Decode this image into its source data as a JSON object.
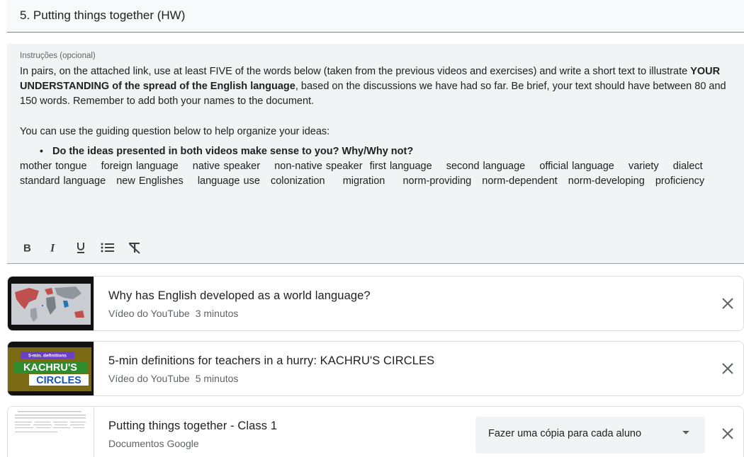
{
  "assignment_title": "5. Putting things together (HW)",
  "instructions": {
    "label": "Instruções (opcional)",
    "paragraph_1_a": "In pairs, on the attached link, use at least FIVE of the words below (taken from the previous videos and exercises) and write a short text to illustrate ",
    "paragraph_1_bold": "YOUR UNDERSTANDING of the spread of the English language",
    "paragraph_1_b": ", based on the discussions we have had so far.  Be brief, your text should have between 80 and 150 words. Remember to add both your names to the document.",
    "paragraph_2": "You can use the guiding question below to help organize your ideas:",
    "bullet": "Do the ideas presented in both videos make sense to you? Why/Why not?",
    "words": "mother tongue    foreign language    native speaker    non-native speaker  first language    second language    official language    variety    dialect   standard language   new Englishes    language use   colonization     migration     norm-providing   norm-dependent   norm-developing   proficiency"
  },
  "toolbar": [
    "bold",
    "italic",
    "underline",
    "bulleted-list",
    "clear-formatting"
  ],
  "attachments": [
    {
      "title": "Why has English developed as a world language?",
      "type": "Vídeo do YouTube",
      "duration": "3 minutos"
    },
    {
      "title": "5-min definitions for teachers in a hurry: KACHRU'S CIRCLES",
      "type": "Vídeo do YouTube",
      "duration": "5 minutos",
      "thumb": {
        "top_text": "5-min. definitions",
        "line1": "KACHRU'S",
        "line2": "CIRCLES"
      }
    },
    {
      "title": "Putting things together - Class 1",
      "type": "Documentos Google",
      "share_option": "Fazer uma cópia para cada aluno"
    }
  ]
}
